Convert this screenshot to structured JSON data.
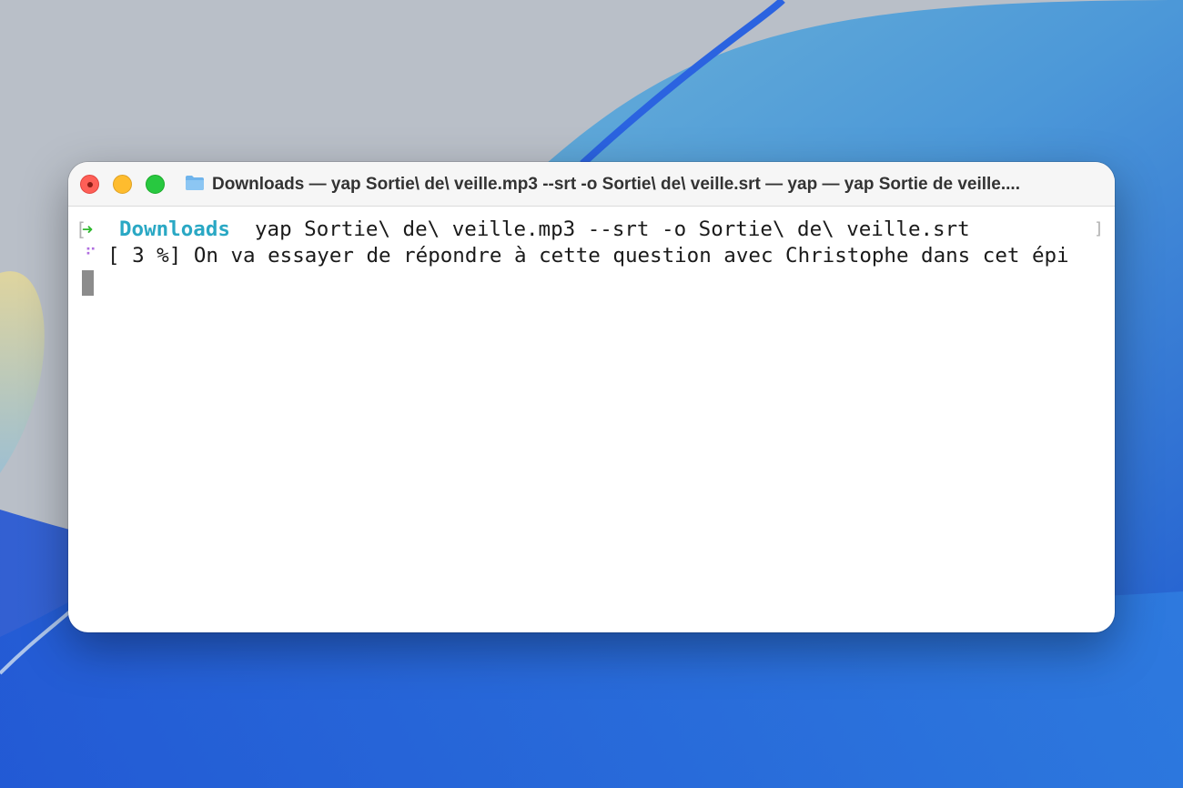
{
  "window": {
    "title": "Downloads — yap Sortie\\ de\\ veille.mp3 --srt -o Sortie\\ de\\ veille.srt — yap — yap Sortie de veille...."
  },
  "terminal": {
    "prompt_bracket_open": "[",
    "prompt_arrow": "➜",
    "prompt_cwd": "Downloads",
    "command": "yap Sortie\\ de\\ veille.mp3 --srt -o Sortie\\ de\\ veille.srt",
    "prompt_bracket_close": "]",
    "spinner": "⠋",
    "progress_line": "[ 3 %] On va essayer de répondre à cette question avec Christophe dans cet épi"
  },
  "colors": {
    "prompt_arrow": "#2fb82f",
    "prompt_cwd": "#2aa8c4",
    "spinner": "#b06ee0",
    "cursor": "#8c8c8c"
  },
  "icons": {
    "window_title": "folder-icon"
  }
}
